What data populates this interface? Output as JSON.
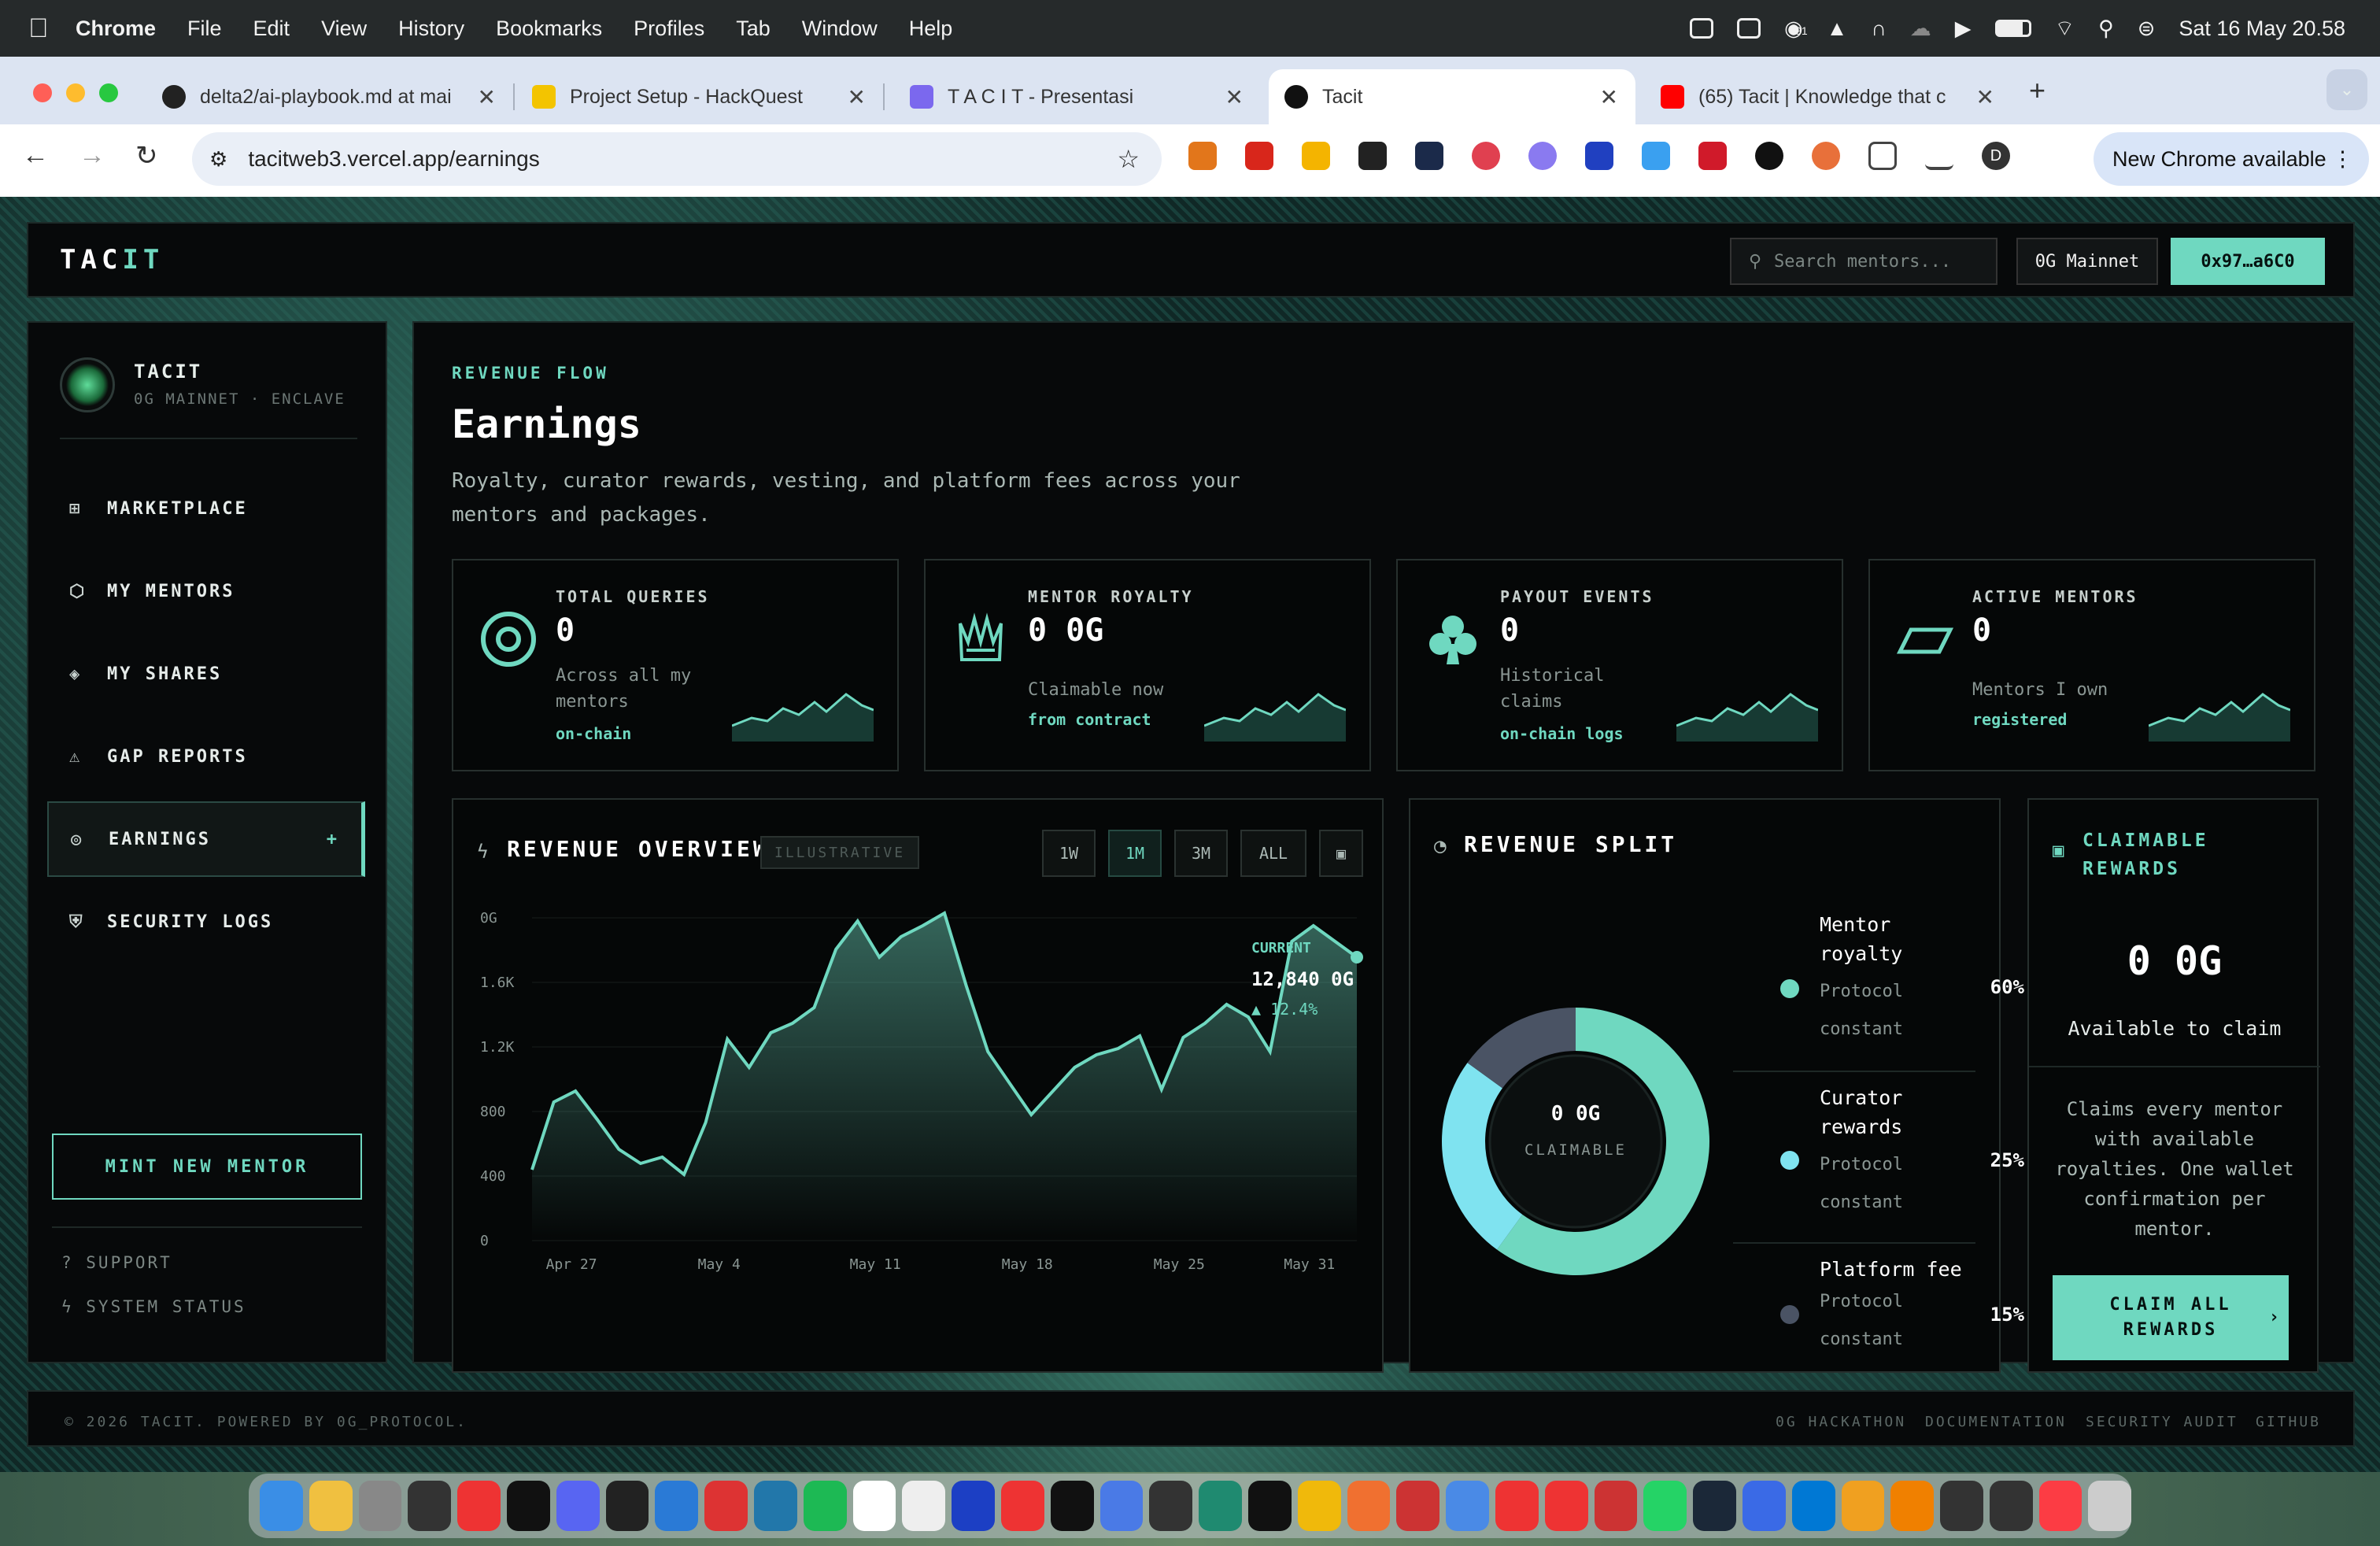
{
  "menubar": {
    "app": "Chrome",
    "items": [
      "File",
      "Edit",
      "View",
      "History",
      "Bookmarks",
      "Profiles",
      "Tab",
      "Window",
      "Help"
    ],
    "clock": "Sat 16 May  20.58",
    "badge": "91"
  },
  "tabs": [
    {
      "label": "delta2/ai-playbook.md at mai",
      "color": "#222"
    },
    {
      "label": "Project Setup - HackQuest",
      "color": "#f3c400"
    },
    {
      "label": "T A C I T - Presentasi",
      "color": "#7b68ee"
    },
    {
      "label": "Tacit",
      "color": "#111"
    },
    {
      "label": "(65) Tacit | Knowledge that c",
      "color": "#ff0000"
    }
  ],
  "url": "tacitweb3.vercel.app/earnings",
  "new_chrome": "New Chrome available",
  "avatar_letter": "D",
  "header": {
    "logo_a": "TAC",
    "logo_b": "IT",
    "search_placeholder": "Search mentors...",
    "network": "0G Mainnet",
    "wallet": "0x97…a6C0"
  },
  "sidebar": {
    "brand": "TACIT",
    "brand_sub": "0G MAINNET · ENCLAVE",
    "items": [
      {
        "label": "MARKETPLACE",
        "icon": "⊞"
      },
      {
        "label": "MY MENTORS",
        "icon": "⬡"
      },
      {
        "label": "MY SHARES",
        "icon": "◈"
      },
      {
        "label": "GAP REPORTS",
        "icon": "⚠"
      },
      {
        "label": "EARNINGS",
        "icon": "◎"
      },
      {
        "label": "SECURITY LOGS",
        "icon": "⛨"
      }
    ],
    "active_plus": "+",
    "mint": "MINT NEW MENTOR",
    "support": "? SUPPORT",
    "status": "ϟ SYSTEM STATUS"
  },
  "main": {
    "eyebrow": "REVENUE FLOW",
    "title": "Earnings",
    "desc": "Royalty, curator rewards, vesting, and platform fees across your mentors and packages."
  },
  "stats": [
    {
      "label": "TOTAL QUERIES",
      "value": "0",
      "desc": "Across all my mentors",
      "tag": "on-chain",
      "icon": "target-icon"
    },
    {
      "label": "MENTOR ROYALTY",
      "value": "0 0G",
      "desc": "Claimable now",
      "tag": "from contract",
      "icon": "crown-icon"
    },
    {
      "label": "PAYOUT EVENTS",
      "value": "0",
      "desc": "Historical claims",
      "tag": "on-chain logs",
      "icon": "club-icon"
    },
    {
      "label": "ACTIVE MENTORS",
      "value": "0",
      "desc": "Mentors I own",
      "tag": "registered",
      "icon": "parallelogram-icon"
    }
  ],
  "overview": {
    "title": "REVENUE OVERVIEW",
    "badge": "ILLUSTRATIVE",
    "ranges": [
      "1W",
      "1M",
      "3M",
      "ALL"
    ],
    "selected": "1M",
    "current_label": "CURRENT",
    "current_value": "12,840 0G",
    "current_delta": "▲ 12.4%"
  },
  "chart_data": {
    "type": "area",
    "x": [
      "Apr 26",
      "Apr 27",
      "Apr 28",
      "Apr 29",
      "Apr 30",
      "May 1",
      "May 2",
      "May 3",
      "May 4",
      "May 5",
      "May 6",
      "May 7",
      "May 8",
      "May 9",
      "May 10",
      "May 11",
      "May 12",
      "May 13",
      "May 14",
      "May 15",
      "May 16",
      "May 17",
      "May 18",
      "May 19",
      "May 20",
      "May 21",
      "May 22",
      "May 23",
      "May 24",
      "May 25",
      "May 26",
      "May 27",
      "May 28",
      "May 29",
      "May 30",
      "May 31",
      "Jun 1",
      "Jun 2",
      "Jun 3"
    ],
    "values": [
      0.45,
      0.88,
      0.95,
      0.77,
      0.58,
      0.49,
      0.53,
      0.42,
      0.75,
      1.28,
      1.1,
      1.32,
      1.38,
      1.48,
      1.85,
      2.03,
      1.8,
      1.93,
      2.0,
      2.08,
      1.62,
      1.2,
      1.0,
      0.8,
      0.95,
      1.1,
      1.18,
      1.22,
      1.3,
      0.96,
      1.29,
      1.38,
      1.5,
      1.42,
      1.2,
      1.9,
      2.0,
      1.9,
      1.8
    ],
    "y_ticks": [
      "0",
      "400",
      "800",
      "1.2K",
      "1.6K",
      "0G"
    ],
    "x_ticks": [
      "Apr 27",
      "May 4",
      "May 11",
      "May 18",
      "May 25",
      "May 31"
    ],
    "ylim": [
      0,
      2.05
    ],
    "color": "#6fd8c0"
  },
  "split": {
    "title": "REVENUE SPLIT",
    "center_value": "0 0G",
    "center_label": "CLAIMABLE",
    "items": [
      {
        "label": "Mentor royalty",
        "sub": "Protocol constant",
        "pct": "60%",
        "value": 60,
        "color": "#6fd8c0"
      },
      {
        "label": "Curator rewards",
        "sub": "Protocol constant",
        "pct": "25%",
        "value": 25,
        "color": "#7fe3f0"
      },
      {
        "label": "Platform fee",
        "sub": "Protocol constant",
        "pct": "15%",
        "value": 15,
        "color": "#4a5364"
      }
    ]
  },
  "claim": {
    "title": "CLAIMABLE REWARDS",
    "value": "0 0G",
    "sub": "Available to claim",
    "desc": "Claims every mentor with available royalties. One wallet confirmation per mentor.",
    "button": "CLAIM ALL REWARDS"
  },
  "footer": {
    "left": "© 2026 TACIT. POWERED BY 0G_PROTOCOL.",
    "links": [
      "0G HACKATHON",
      "DOCUMENTATION",
      "SECURITY AUDIT",
      "GITHUB"
    ]
  },
  "dock_colors": [
    "#3a8ee6",
    "#f0c040",
    "#888",
    "#333",
    "#e33",
    "#111",
    "#5865f2",
    "#222",
    "#2a7ad6",
    "#d33",
    "#27a",
    "#1db954",
    "#fff",
    "#eee",
    "#1c3fc4",
    "#e33",
    "#111",
    "#4a7ae6",
    "#333",
    "#1f8a70",
    "#111",
    "#f0b90b",
    "#f07030",
    "#c33",
    "#4a8ae6",
    "#e33",
    "#e33",
    "#c33",
    "#25d366",
    "#1b2838",
    "#3a6ae6",
    "#0078d4",
    "#f0a020",
    "#f08000",
    "#333",
    "#333",
    "#fc3c44",
    "#ccc"
  ]
}
